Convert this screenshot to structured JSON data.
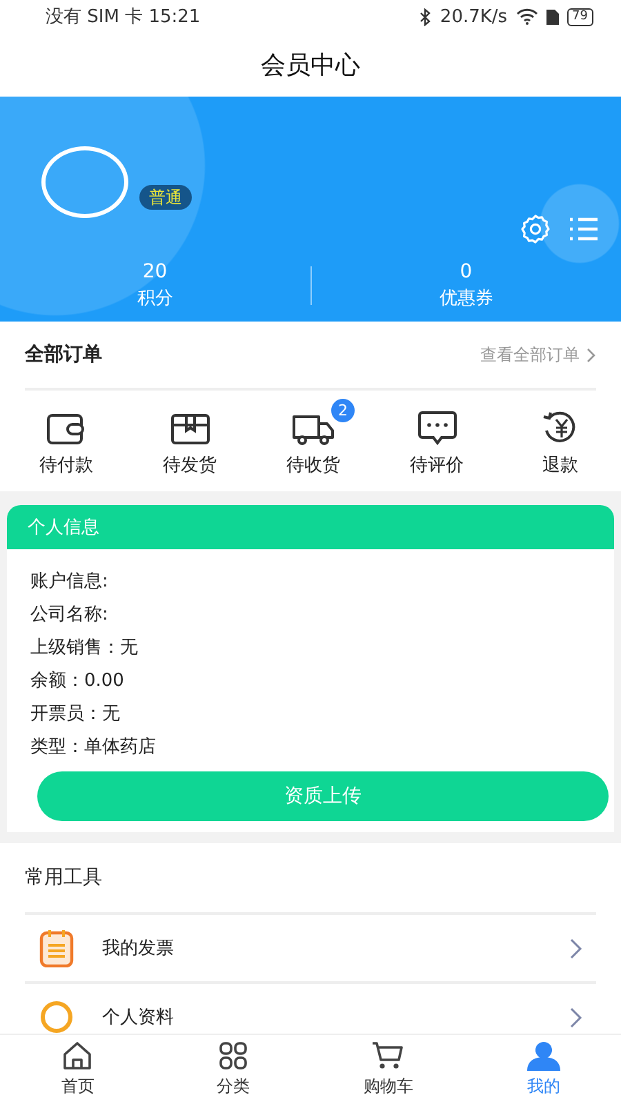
{
  "status_bar": {
    "carrier_time": "没有 SIM 卡 15:21",
    "speed": "20.7K/s",
    "battery": "79"
  },
  "title": "会员中心",
  "profile": {
    "level_badge": "普通",
    "stats": [
      {
        "value": "20",
        "label": "积分"
      },
      {
        "value": "0",
        "label": "优惠券"
      }
    ]
  },
  "orders": {
    "title": "全部订单",
    "view_all": "查看全部订单",
    "items": [
      {
        "kind": "wallet",
        "label": "待付款"
      },
      {
        "kind": "box",
        "label": "待发货"
      },
      {
        "kind": "truck",
        "label": "待收货",
        "badge": "2"
      },
      {
        "kind": "chat",
        "label": "待评价"
      },
      {
        "kind": "refund",
        "label": "退款"
      }
    ]
  },
  "personal_info": {
    "title": "个人信息",
    "fields": [
      "账户信息:",
      "公司名称:",
      "上级销售：无",
      "余额：0.00",
      "开票员：无",
      "类型：单体药店"
    ],
    "upload_button": "资质上传"
  },
  "tools": {
    "title": "常用工具",
    "items": [
      {
        "kind": "invoice",
        "label": "我的发票"
      },
      {
        "kind": "profile",
        "label": "个人资料"
      }
    ]
  },
  "tab_bar": [
    {
      "kind": "home",
      "label": "首页",
      "selected": false
    },
    {
      "kind": "grid",
      "label": "分类",
      "selected": false
    },
    {
      "kind": "cart",
      "label": "购物车",
      "selected": false
    },
    {
      "kind": "user",
      "label": "我的",
      "selected": true
    }
  ]
}
